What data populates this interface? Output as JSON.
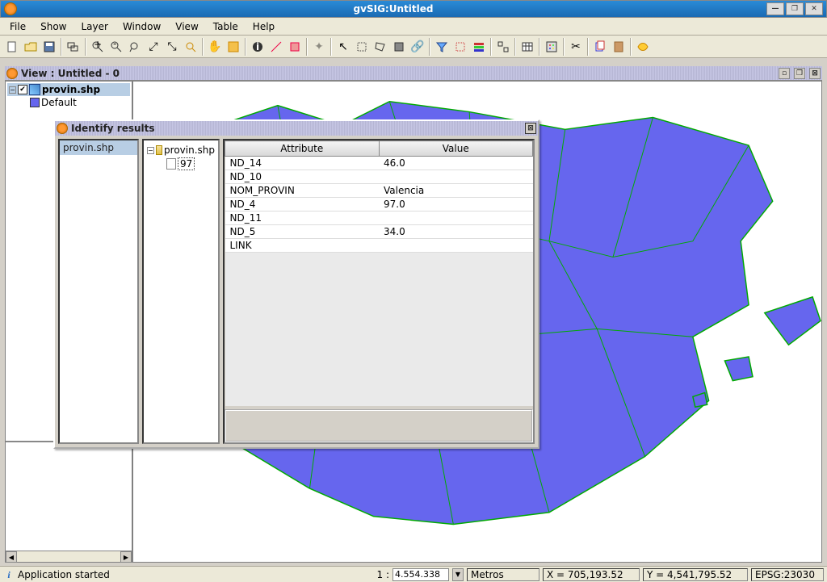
{
  "titlebar": {
    "text": "gvSIG:Untitled"
  },
  "menu": {
    "file": "File",
    "show": "Show",
    "layer": "Layer",
    "window": "Window",
    "view": "View",
    "table": "Table",
    "help": "Help"
  },
  "view_window": {
    "title": "View : Untitled - 0"
  },
  "toc": {
    "layer_name": "provin.shp",
    "legend_label": "Default",
    "checked": "✔"
  },
  "identify": {
    "title": "Identify results",
    "layer_list_item": "provin.shp",
    "tree_root": "provin.shp",
    "tree_child": "97",
    "headers": {
      "attr": "Attribute",
      "value": "Value"
    },
    "rows": [
      {
        "attr": "ND_14",
        "value": "46.0"
      },
      {
        "attr": "ND_10",
        "value": ""
      },
      {
        "attr": "NOM_PROVIN",
        "value": "Valencia"
      },
      {
        "attr": "ND_4",
        "value": "97.0"
      },
      {
        "attr": "ND_11",
        "value": ""
      },
      {
        "attr": "ND_5",
        "value": "34.0"
      },
      {
        "attr": "LINK",
        "value": ""
      }
    ]
  },
  "statusbar": {
    "message": "Application started",
    "scale_prefix": "1 :",
    "scale_value": "4.554.338",
    "units": "Metros",
    "x": "X = 705,193.52",
    "y": "Y = 4,541,795.52",
    "epsg": "EPSG:23030"
  }
}
